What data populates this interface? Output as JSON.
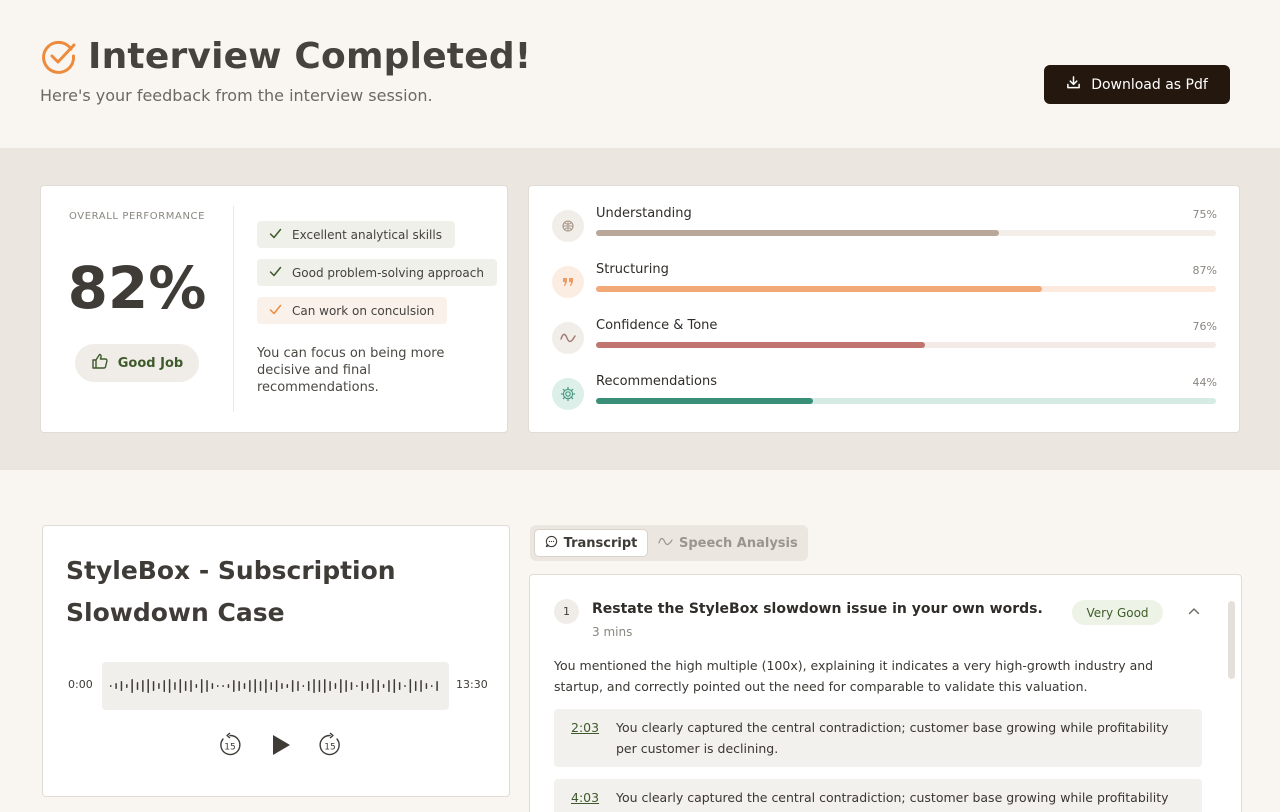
{
  "header": {
    "title": "Interview Completed!",
    "subtitle": "Here's your feedback from the interview session.",
    "download_label": "Download as Pdf"
  },
  "overall": {
    "label": "OVERALL PERFORMANCE",
    "value": "82%",
    "rating": "Good Job",
    "highlights": [
      {
        "text": "Excellent analytical skills",
        "type": "positive"
      },
      {
        "text": "Good problem-solving approach",
        "type": "positive"
      },
      {
        "text": "Can work on conculsion",
        "type": "improve"
      }
    ],
    "focus_note": "You can focus on being more decisive and final recommendations."
  },
  "scores": [
    {
      "label": "Understanding",
      "pct_text": "75%",
      "fill": 0.65,
      "icon": "brain-icon",
      "color": "#b9a89a",
      "track": "#f4eee9",
      "icon_bg": "#f1ede8",
      "icon_fg": "#a69586"
    },
    {
      "label": "Structuring",
      "pct_text": "87%",
      "fill": 0.72,
      "icon": "quote-icon",
      "color": "#f2a977",
      "track": "#fbeadd",
      "icon_bg": "#fbede2",
      "icon_fg": "#ec9a66"
    },
    {
      "label": "Confidence & Tone",
      "pct_text": "76%",
      "fill": 0.53,
      "icon": "wave-icon",
      "color": "#c07570",
      "track": "#f4ebe8",
      "icon_bg": "#f1ede8",
      "icon_fg": "#a0786e"
    },
    {
      "label": "Recommendations",
      "pct_text": "44%",
      "fill": 0.35,
      "icon": "gear-icon",
      "color": "#3a8f78",
      "track": "#d6ebe3",
      "icon_bg": "#dcefe8",
      "icon_fg": "#4a9a84"
    }
  ],
  "case": {
    "title": "StyleBox - Subscription Slowdown Case",
    "time_start": "0:00",
    "time_end": "13:30",
    "rewind_label": "15",
    "forward_label": "15"
  },
  "tabs": {
    "transcript": "Transcript",
    "speech": "Speech Analysis"
  },
  "question": {
    "number": "1",
    "text": "Restate the StyleBox slowdown issue in your own words.",
    "duration": "3 mins",
    "badge": "Very Good",
    "body": "You mentioned the high multiple (100x), explaining it indicates a very high-growth industry and startup, and correctly pointed out the need for comparable to validate this valuation.",
    "timestamps": [
      {
        "time": "2:03",
        "text": "You clearly captured the central contradiction; customer base growing while profitability per customer is declining."
      },
      {
        "time": "4:03",
        "text": "You clearly captured the central contradiction; customer base growing while profitability per customer is declining."
      }
    ]
  }
}
